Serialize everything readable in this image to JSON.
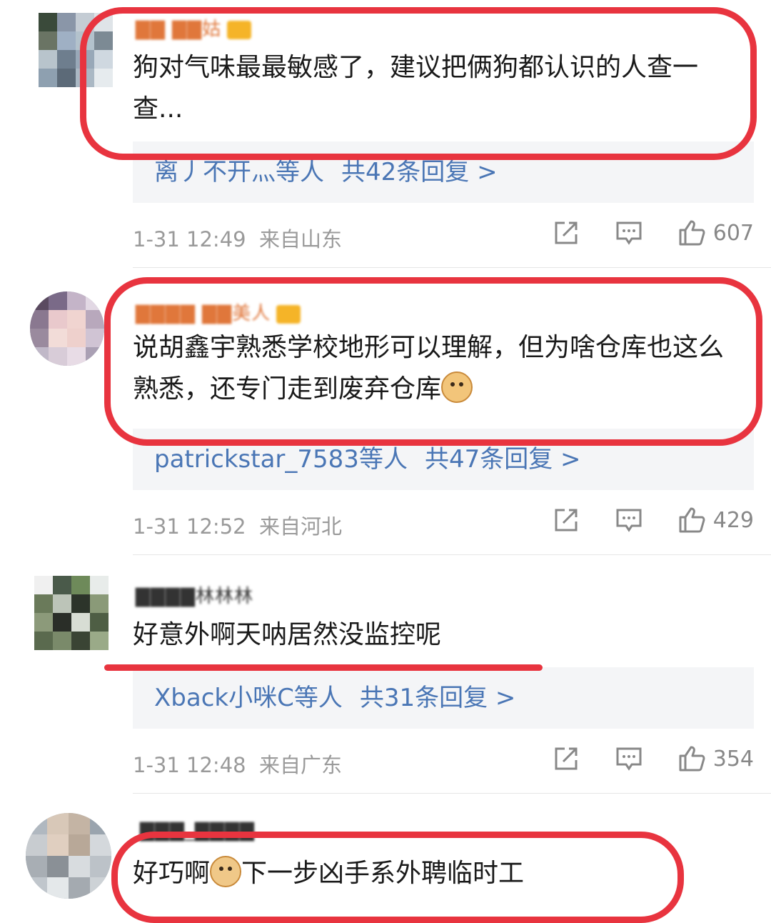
{
  "comments": [
    {
      "username": "▇▇ ▇▇姑",
      "text": "狗对气味最最敏感了，建议把俩狗都认识的人查一查...",
      "reply": {
        "who": "离丿不开灬",
        "etc": "等人",
        "total": "共42条回复 >"
      },
      "time": "1-31 12:49",
      "location": "来自山东",
      "likes": "607"
    },
    {
      "username": "▇▇▇▇ ▇▇美人",
      "text": "说胡鑫宇熟悉学校地形可以理解，但为啥仓库也这么熟悉，还专门走到废弃仓库",
      "reply": {
        "who": "patrickstar_7583",
        "etc": "等人",
        "total": "共47条回复 >"
      },
      "time": "1-31 12:52",
      "location": "来自河北",
      "likes": "429"
    },
    {
      "username": "▇▇▇▇林林林",
      "text": "好意外啊天呐居然没监控呢",
      "reply": {
        "who": "Xback小咪C",
        "etc": "等人",
        "total": "共31条回复 >"
      },
      "time": "1-31 12:48",
      "location": "来自广东",
      "likes": "354"
    },
    {
      "username": "▇▇▇_▇▇▇▇",
      "text_a": "好巧啊",
      "text_b": "下一步凶手系外聘临时工"
    }
  ],
  "icons": {
    "share": "share-icon",
    "comment": "comment-icon",
    "like": "thumbs-up-icon"
  },
  "colors": {
    "highlight": "#e8343f",
    "link": "#4a76b5",
    "meta": "#9a9a9a"
  }
}
